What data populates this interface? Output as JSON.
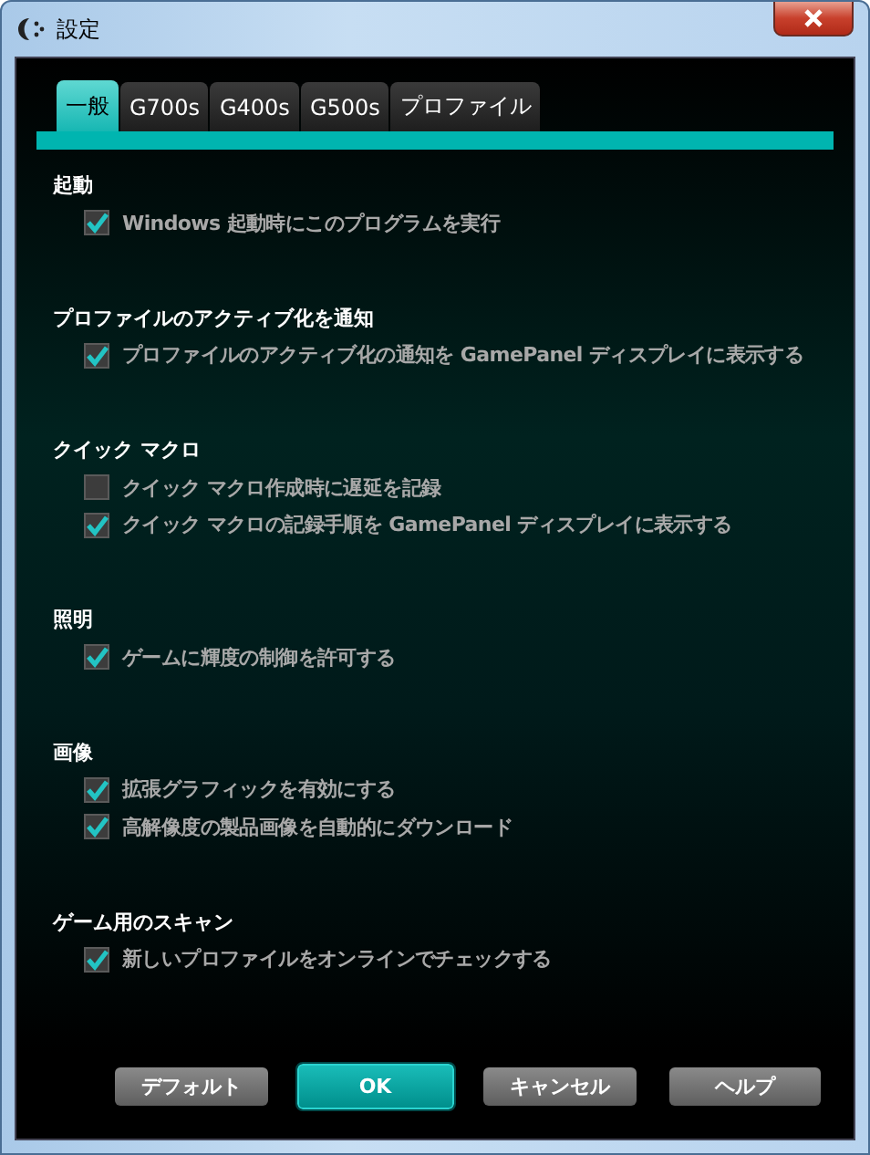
{
  "window": {
    "title": "設定"
  },
  "tabs": [
    {
      "label": "一般",
      "selected": true
    },
    {
      "label": "G700s",
      "selected": false
    },
    {
      "label": "G400s",
      "selected": false
    },
    {
      "label": "G500s",
      "selected": false
    },
    {
      "label": "プロファイル",
      "selected": false
    }
  ],
  "sections": [
    {
      "heading": "起動",
      "options": [
        {
          "label": "Windows 起動時にこのプログラムを実行",
          "checked": true
        }
      ]
    },
    {
      "heading": "プロファイルのアクティブ化を通知",
      "options": [
        {
          "label": "プロファイルのアクティブ化の通知を GamePanel ディスプレイに表示する",
          "checked": true
        }
      ]
    },
    {
      "heading": "クイック マクロ",
      "options": [
        {
          "label": "クイック マクロ作成時に遅延を記録",
          "checked": false
        },
        {
          "label": "クイック マクロの記録手順を GamePanel ディスプレイに表示する",
          "checked": true
        }
      ]
    },
    {
      "heading": "照明",
      "options": [
        {
          "label": "ゲームに輝度の制御を許可する",
          "checked": true
        }
      ]
    },
    {
      "heading": "画像",
      "options": [
        {
          "label": "拡張グラフィックを有効にする",
          "checked": true
        },
        {
          "label": "高解像度の製品画像を自動的にダウンロード",
          "checked": true
        }
      ]
    },
    {
      "heading": "ゲーム用のスキャン",
      "options": [
        {
          "label": "新しいプロファイルをオンラインでチェックする",
          "checked": true
        }
      ]
    }
  ],
  "buttons": [
    {
      "label": "デフォルト",
      "primary": false
    },
    {
      "label": "OK",
      "primary": true
    },
    {
      "label": "キャンセル",
      "primary": false
    },
    {
      "label": "ヘルプ",
      "primary": false
    }
  ]
}
